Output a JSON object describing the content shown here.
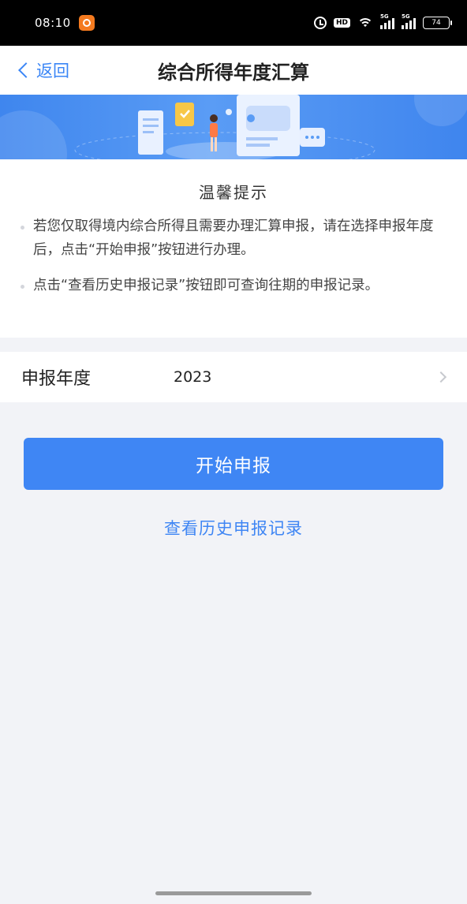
{
  "status_bar": {
    "time": "08:10",
    "hd_label": "HD",
    "signal_1_label": "5G",
    "signal_2_label": "5G",
    "battery": "74"
  },
  "nav": {
    "back_label": "返回",
    "title": "综合所得年度汇算"
  },
  "tips": {
    "title": "温馨提示",
    "items": [
      "若您仅取得境内综合所得且需要办理汇算申报，请在选择申报年度后，点击“开始申报”按钮进行办理。",
      "点击“查看历史申报记录”按钮即可查询往期的申报记录。"
    ]
  },
  "year_row": {
    "label": "申报年度",
    "value": "2023"
  },
  "actions": {
    "start_label": "开始申报",
    "history_label": "查看历史申报记录"
  },
  "colors": {
    "accent": "#3f86f4",
    "banner": "#4a8ef2",
    "background": "#f2f3f7"
  }
}
